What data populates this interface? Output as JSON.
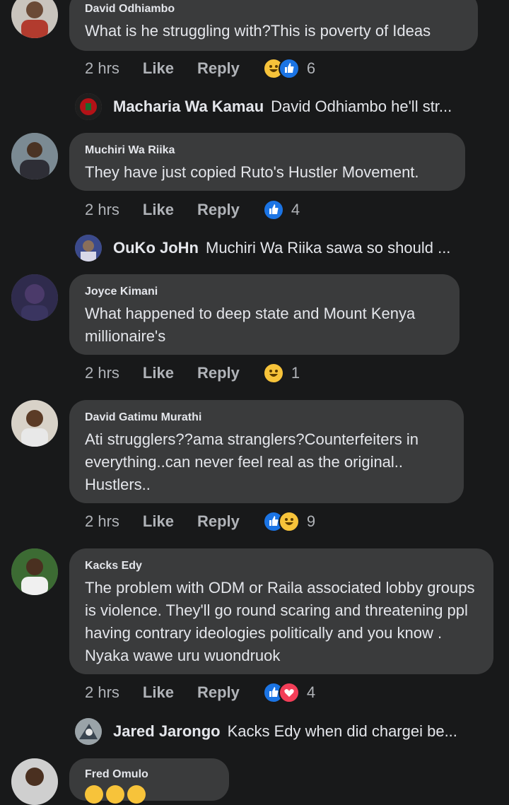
{
  "comments": [
    {
      "author": "David Odhiambo",
      "text": "What is he struggling with?This is poverty of Ideas",
      "time": "2 hrs",
      "like": "Like",
      "reply": "Reply",
      "reactions": [
        "haha",
        "like"
      ],
      "count": "6",
      "reply_preview": {
        "name": "Macharia Wa Kamau",
        "snippet": "David Odhiambo  he'll str..."
      }
    },
    {
      "author": "Muchiri Wa Riika",
      "text": "They have just copied Ruto's Hustler Movement.",
      "time": "2 hrs",
      "like": "Like",
      "reply": "Reply",
      "reactions": [
        "like"
      ],
      "count": "4",
      "reply_preview": {
        "name": "OuKo JoHn",
        "snippet": "Muchiri Wa Riika sawa so should ..."
      }
    },
    {
      "author": "Joyce Kimani",
      "text": "What happened to deep state and Mount Kenya millionaire's",
      "time": "2 hrs",
      "like": "Like",
      "reply": "Reply",
      "reactions": [
        "haha"
      ],
      "count": "1"
    },
    {
      "author": "David Gatimu Murathi",
      "text": "Ati strugglers??ama stranglers?Counterfeiters in everything..can never feel real as the original.. Hustlers..",
      "time": "2 hrs",
      "like": "Like",
      "reply": "Reply",
      "reactions": [
        "like",
        "haha"
      ],
      "count": "9"
    },
    {
      "author": "Kacks Edy",
      "text": "The problem with ODM or Raila associated lobby groups is violence. They'll go round scaring and threatening ppl having contrary ideologies politically and you know . Nyaka wawe uru wuondruok",
      "time": "2 hrs",
      "like": "Like",
      "reply": "Reply",
      "reactions": [
        "like",
        "love"
      ],
      "count": "4",
      "reply_preview": {
        "name": "Jared Jarongo",
        "snippet": "Kacks Edy when did chargei be..."
      }
    },
    {
      "author": "Fred Omulo"
    }
  ]
}
